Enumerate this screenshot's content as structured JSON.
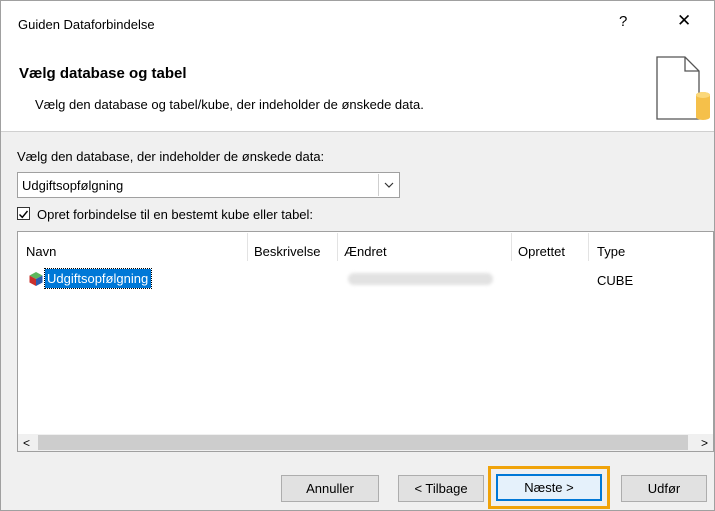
{
  "window": {
    "title": "Guiden Dataforbindelse",
    "help_label": "?",
    "close_label": "✕"
  },
  "header": {
    "title": "Vælg database og tabel",
    "subtitle": "Vælg den database og tabel/kube, der indeholder de ønskede data."
  },
  "database": {
    "label": "Vælg den database, der indeholder de ønskede data:",
    "selected": "Udgiftsopfølgning"
  },
  "connect_checkbox": {
    "label": "Opret forbindelse til en bestemt kube eller tabel:",
    "checked": true
  },
  "table": {
    "columns": [
      "Navn",
      "Beskrivelse",
      "Ændret",
      "Oprettet",
      "Type"
    ],
    "rows": [
      {
        "name": "Udgiftsopfølgning",
        "description": "",
        "modified": "",
        "created": "",
        "type": "CUBE"
      }
    ]
  },
  "scrollbar": {
    "left_arrow": "<",
    "right_arrow": ">"
  },
  "buttons": {
    "cancel": "Annuller",
    "back": "< Tilbage",
    "next": "Næste >",
    "finish": "Udfør"
  },
  "colors": {
    "selection": "#0078d7",
    "focus_highlight": "#f0a30a",
    "icon_cylinder": "#f5c04a"
  }
}
